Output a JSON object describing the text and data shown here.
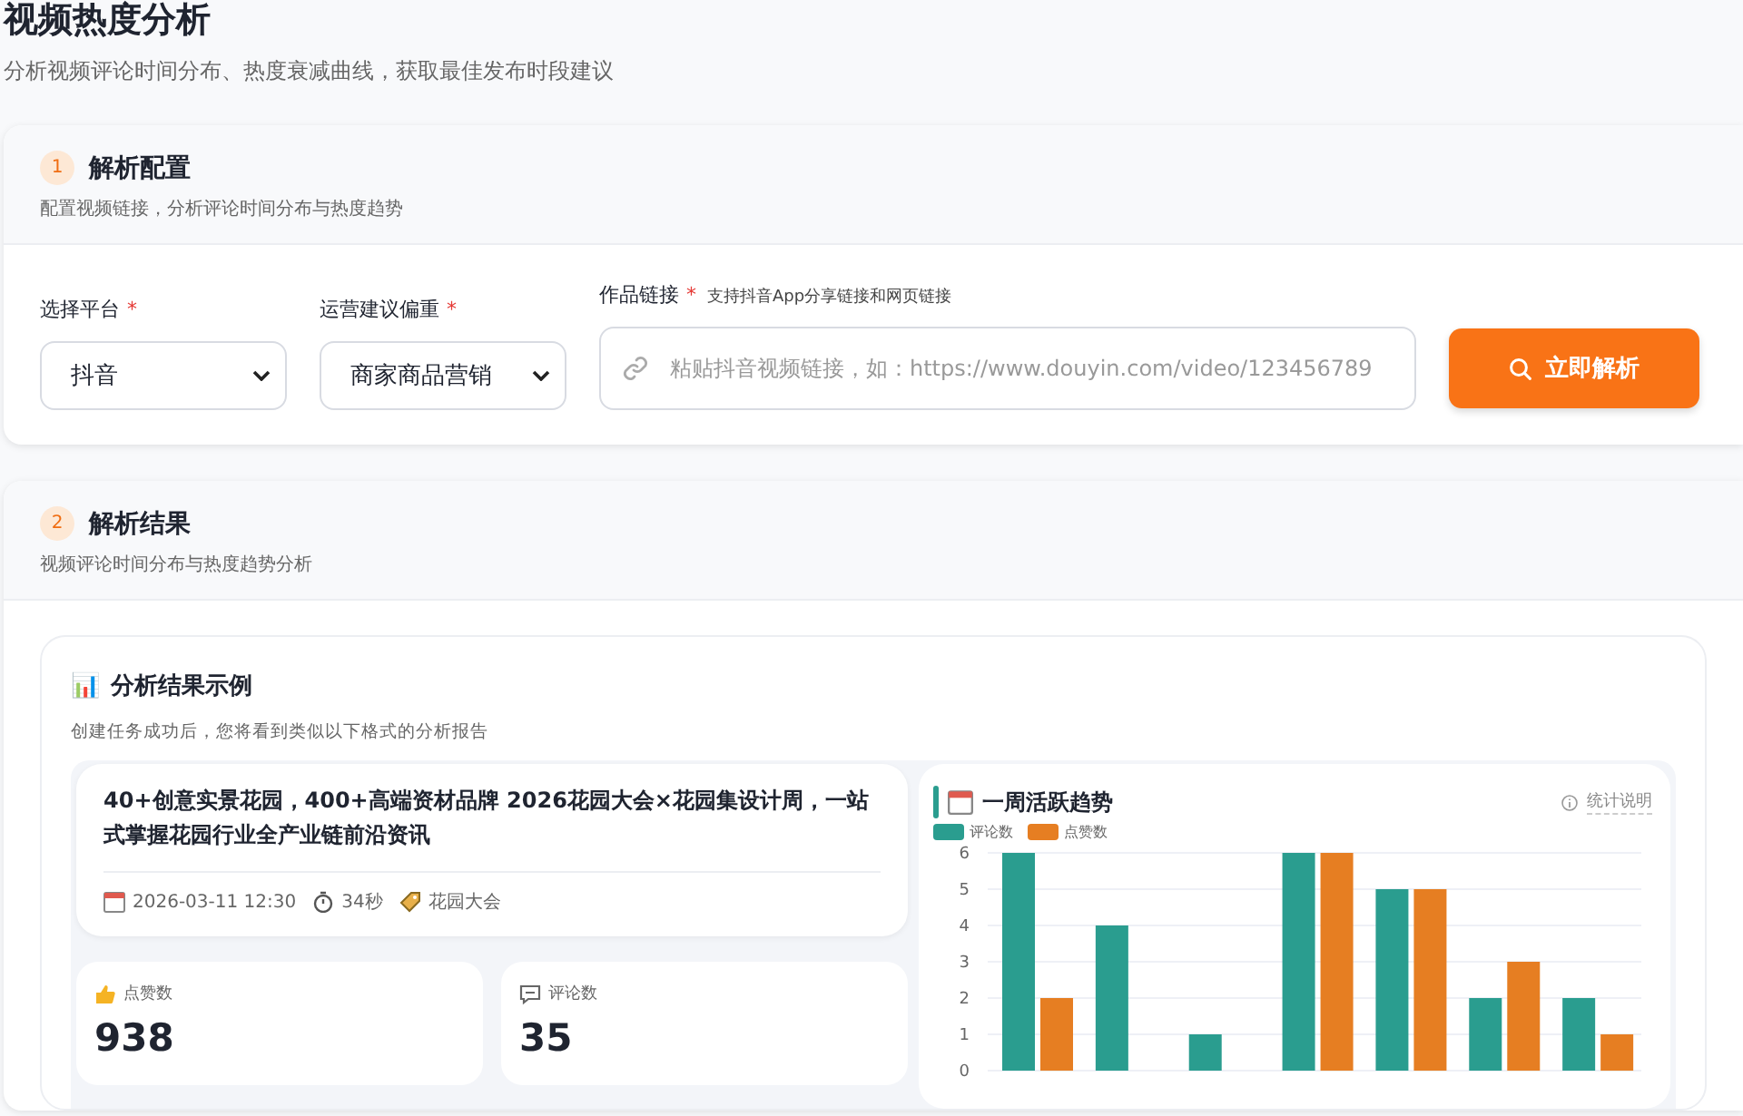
{
  "page": {
    "title": "视频热度分析",
    "subtitle": "分析视频评论时间分布、热度衰减曲线，获取最佳发布时段建议"
  },
  "config": {
    "step": "1",
    "title": "解析配置",
    "subtitle": "配置视频链接，分析评论时间分布与热度趋势",
    "fields": [
      {
        "kind": "select",
        "label": "选择平台",
        "required": "*",
        "value": "抖音"
      },
      {
        "kind": "select",
        "label": "运营建议偏重",
        "required": "*",
        "value": "商家商品营销"
      },
      {
        "kind": "input",
        "label": "作品链接",
        "required": "*",
        "hint": "支持抖音App分享链接和网页链接",
        "placeholder": "粘贴抖音视频链接，如：https://www.douyin.com/video/123456789"
      }
    ],
    "button": "立即解析"
  },
  "results": {
    "step": "2",
    "title": "解析结果",
    "subtitle": "视频评论时间分布与热度趋势分析",
    "example": {
      "icon": "📊",
      "title": "分析结果示例",
      "subtitle": "创建任务成功后，您将看到类似以下格式的分析报告",
      "video": {
        "title": "40+创意实景花园，400+高端资材品牌 2026花园大会×花园集设计周，一站式掌握花园行业全产业链前沿资讯",
        "date": "2026-03-11 12:30",
        "duration": "34秒",
        "tag": "花园大会"
      },
      "stats": [
        {
          "kind": "likes",
          "label": "点赞数",
          "value": "938"
        },
        {
          "kind": "comments",
          "label": "评论数",
          "value": "35"
        }
      ],
      "trend": {
        "title": "一周活跃趋势",
        "help": "统计说明",
        "chart_data": {
          "type": "bar",
          "grid": true,
          "ylim": [
            0,
            6
          ],
          "yticks": [
            0,
            1,
            2,
            3,
            4,
            5,
            6
          ],
          "series": [
            {
              "name": "评论数",
              "color": "#2a9d8f",
              "values": [
                6,
                4,
                1,
                6,
                5,
                2,
                2
              ]
            },
            {
              "name": "点赞数",
              "color": "#e67e22",
              "values": [
                2,
                0,
                0,
                6,
                5,
                3,
                1
              ]
            }
          ]
        }
      }
    }
  }
}
